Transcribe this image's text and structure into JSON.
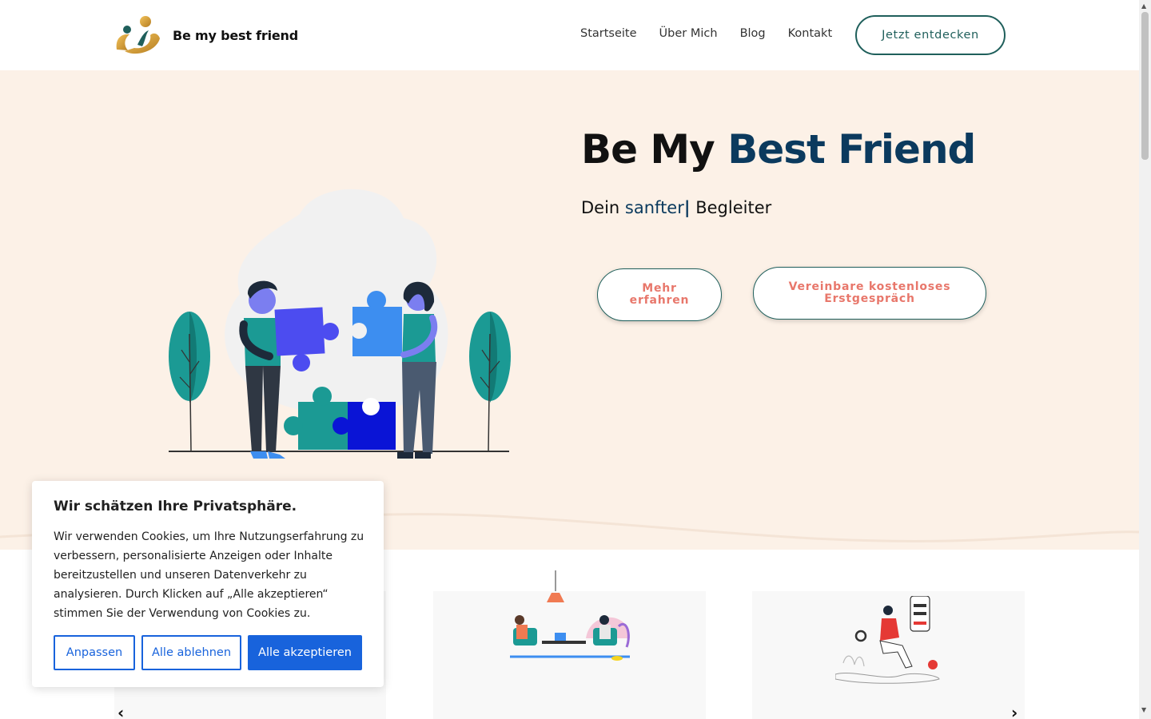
{
  "header": {
    "brand": "Be my best friend",
    "nav": [
      "Startseite",
      "Über Mich",
      "Blog",
      "Kontakt"
    ],
    "cta": "Jetzt entdecken"
  },
  "hero": {
    "title_plain": "Be My",
    "title_accent": "Best Friend",
    "subtitle_prefix": "Dein",
    "subtitle_typed": "sanfter",
    "subtitle_cursor": "|",
    "subtitle_suffix": "Begleiter",
    "btn_more_line1": "Mehr",
    "btn_more_line2": "erfahren",
    "btn_consult_line1": "Vereinbare kostenloses",
    "btn_consult_line2": "Erstgespräch"
  },
  "carousel": {
    "prev": "‹",
    "next": "›"
  },
  "cookie": {
    "title": "Wir schätzen Ihre Privatsphäre.",
    "text": "Wir verwenden Cookies, um Ihre Nutzungserfahrung zu verbessern, personalisierte Anzeigen oder Inhalte bereitzustellen und unseren Datenverkehr zu analysieren. Durch Klicken auf „Alle akzeptieren“ stimmen Sie der Verwendung von Cookies zu.",
    "customize": "Anpassen",
    "reject": "Alle ablehnen",
    "accept": "Alle akzeptieren"
  },
  "colors": {
    "hero_bg": "#fcf1e7",
    "accent_navy": "#0b3a5e",
    "teal": "#1f5f5b",
    "coral": "#e8776b",
    "cookie_blue": "#1863dc"
  },
  "icons": {
    "logo": "two-figures-logo-icon",
    "hero": "puzzle-people-illustration",
    "card2": "therapy-session-illustration",
    "card3": "person-with-phone-illustration"
  }
}
